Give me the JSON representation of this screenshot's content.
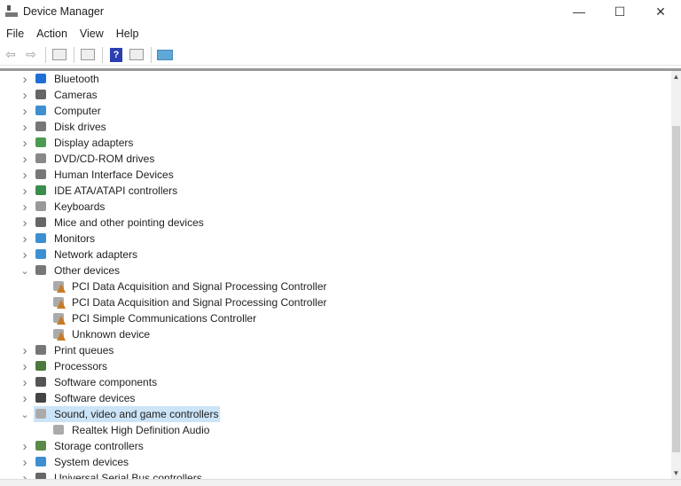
{
  "window": {
    "title": "Device Manager",
    "minimize": "—",
    "maximize": "☐",
    "close": "✕"
  },
  "menu": [
    "File",
    "Action",
    "View",
    "Help"
  ],
  "toolbar": {
    "back": "⇦",
    "forward": "⇨",
    "help": "?"
  },
  "tree": [
    {
      "label": "Bluetooth",
      "icon": "bluetooth-icon",
      "state": "collapsed",
      "level": 0
    },
    {
      "label": "Cameras",
      "icon": "camera-icon",
      "state": "collapsed",
      "level": 0
    },
    {
      "label": "Computer",
      "icon": "computer-icon",
      "state": "collapsed",
      "level": 0
    },
    {
      "label": "Disk drives",
      "icon": "disk-drive-icon",
      "state": "collapsed",
      "level": 0
    },
    {
      "label": "Display adapters",
      "icon": "display-adapter-icon",
      "state": "collapsed",
      "level": 0
    },
    {
      "label": "DVD/CD-ROM drives",
      "icon": "dvd-drive-icon",
      "state": "collapsed",
      "level": 0
    },
    {
      "label": "Human Interface Devices",
      "icon": "hid-icon",
      "state": "collapsed",
      "level": 0
    },
    {
      "label": "IDE ATA/ATAPI controllers",
      "icon": "ide-controller-icon",
      "state": "collapsed",
      "level": 0
    },
    {
      "label": "Keyboards",
      "icon": "keyboard-icon",
      "state": "collapsed",
      "level": 0
    },
    {
      "label": "Mice and other pointing devices",
      "icon": "mouse-icon",
      "state": "collapsed",
      "level": 0
    },
    {
      "label": "Monitors",
      "icon": "monitor-icon",
      "state": "collapsed",
      "level": 0
    },
    {
      "label": "Network adapters",
      "icon": "network-adapter-icon",
      "state": "collapsed",
      "level": 0
    },
    {
      "label": "Other devices",
      "icon": "other-devices-icon",
      "state": "expanded",
      "level": 0
    },
    {
      "label": "PCI Data Acquisition and Signal Processing Controller",
      "icon": "device-warning-icon",
      "level": 1
    },
    {
      "label": "PCI Data Acquisition and Signal Processing Controller",
      "icon": "device-warning-icon",
      "level": 1
    },
    {
      "label": "PCI Simple Communications Controller",
      "icon": "device-warning-icon",
      "level": 1
    },
    {
      "label": "Unknown device",
      "icon": "device-warning-icon",
      "level": 1
    },
    {
      "label": "Print queues",
      "icon": "printer-icon",
      "state": "collapsed",
      "level": 0
    },
    {
      "label": "Processors",
      "icon": "processor-icon",
      "state": "collapsed",
      "level": 0
    },
    {
      "label": "Software components",
      "icon": "software-component-icon",
      "state": "collapsed",
      "level": 0
    },
    {
      "label": "Software devices",
      "icon": "software-device-icon",
      "state": "collapsed",
      "level": 0
    },
    {
      "label": "Sound, video and game controllers",
      "icon": "speaker-icon",
      "state": "expanded",
      "level": 0,
      "selected": true
    },
    {
      "label": "Realtek High Definition Audio",
      "icon": "speaker-icon",
      "level": 1
    },
    {
      "label": "Storage controllers",
      "icon": "storage-controller-icon",
      "state": "collapsed",
      "level": 0
    },
    {
      "label": "System devices",
      "icon": "system-devices-icon",
      "state": "collapsed",
      "level": 0
    },
    {
      "label": "Universal Serial Bus controllers",
      "icon": "usb-icon",
      "state": "collapsed",
      "level": 0
    }
  ],
  "colors": {
    "selection": "#cce4f7",
    "warning": "#c77b2a"
  }
}
